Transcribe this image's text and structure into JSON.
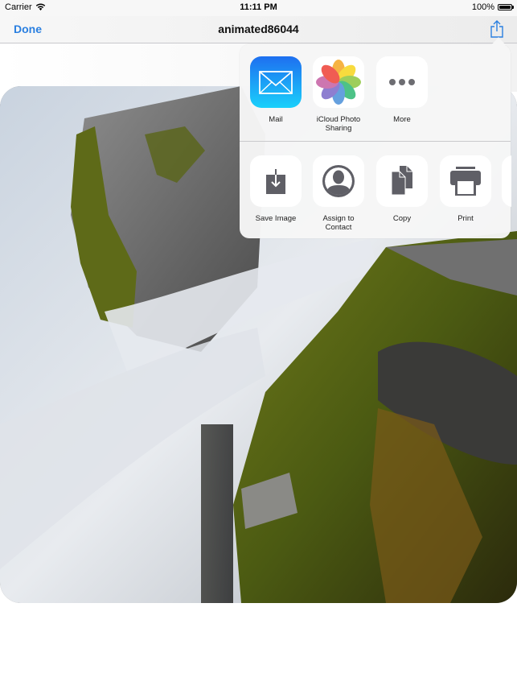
{
  "status_bar": {
    "carrier": "Carrier",
    "time": "11:11 PM",
    "battery": "100%",
    "battery_level": 1.0
  },
  "nav_bar": {
    "done_label": "Done",
    "title": "animated86044",
    "accent_color": "#2a7fe0"
  },
  "share_sheet": {
    "apps": [
      {
        "label": "Mail",
        "icon": "mail-icon"
      },
      {
        "label": "iCloud Photo Sharing",
        "label_lines": [
          "iCloud Photo",
          "Sharing"
        ],
        "icon": "photos-icon"
      },
      {
        "label": "More",
        "icon": "more-icon"
      }
    ],
    "actions": [
      {
        "label": "Save Image",
        "icon": "save-image-icon"
      },
      {
        "label": "Assign to Contact",
        "label_lines": [
          "Assign to",
          "Contact"
        ],
        "icon": "contact-icon"
      },
      {
        "label": "Copy",
        "icon": "copy-icon"
      },
      {
        "label": "Print",
        "icon": "print-icon"
      }
    ]
  },
  "image": {
    "description": "Long-exposure waterfall flowing over moss-covered rocks"
  }
}
